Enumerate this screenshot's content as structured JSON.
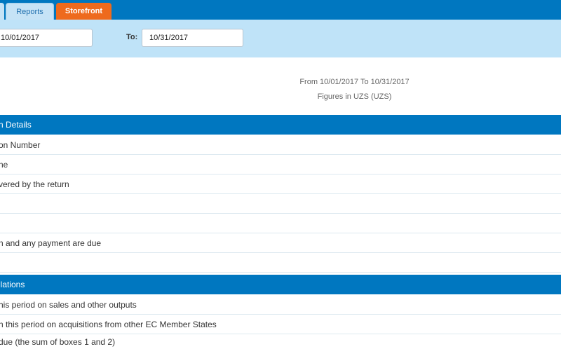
{
  "tabs": [
    {
      "label": ""
    },
    {
      "label": "Reports"
    },
    {
      "label": "Storefront"
    }
  ],
  "filter": {
    "from_value": "10/01/2017",
    "to_label": "To:",
    "to_value": "10/31/2017"
  },
  "report": {
    "period": "From 10/01/2017 To 10/31/2017",
    "figures": "Figures in UZS (UZS)"
  },
  "sections": [
    {
      "title": "n Details",
      "rows": [
        "on Number",
        "ne",
        "vered by the return",
        "",
        "",
        "n and any payment are due",
        ""
      ]
    },
    {
      "title": "llations",
      "rows": [
        "his period on sales and other outputs",
        "n this period on acquisitions from other EC Member States",
        "due (the sum of boxes 1 and 2)"
      ]
    }
  ]
}
